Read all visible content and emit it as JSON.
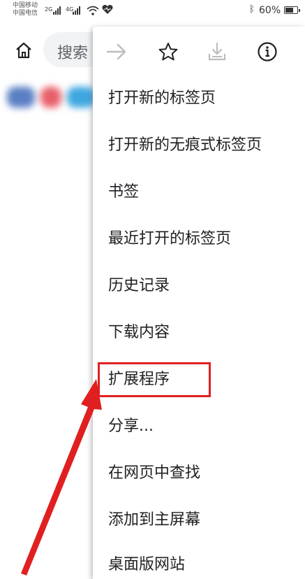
{
  "status_bar": {
    "carrier_line_1": "中国移动",
    "carrier_line_2": "中国电信",
    "network_1": "2G",
    "network_2": "4G",
    "battery_text": "60%",
    "icons": [
      "signal-icon",
      "wifi-icon",
      "health-heart-icon",
      "bluetooth-icon",
      "battery-icon"
    ]
  },
  "toolbar": {
    "search_text": "搜索",
    "icons": [
      "home-icon"
    ]
  },
  "menu": {
    "icon_row": [
      "forward-arrow-icon",
      "bookmark-star-icon",
      "download-icon",
      "info-icon"
    ],
    "items": [
      {
        "label": "打开新的标签页"
      },
      {
        "label": "打开新的无痕式标签页"
      },
      {
        "label": "书签"
      },
      {
        "label": "最近打开的标签页"
      },
      {
        "label": "历史记录"
      },
      {
        "label": "下载内容"
      },
      {
        "label": "扩展程序"
      },
      {
        "label": "分享..."
      },
      {
        "label": "在网页中查找"
      },
      {
        "label": "添加到主屏幕"
      },
      {
        "label": "桌面版网站"
      }
    ]
  },
  "annotation": {
    "highlighted_item": "扩展程序",
    "color": "#e02020"
  }
}
